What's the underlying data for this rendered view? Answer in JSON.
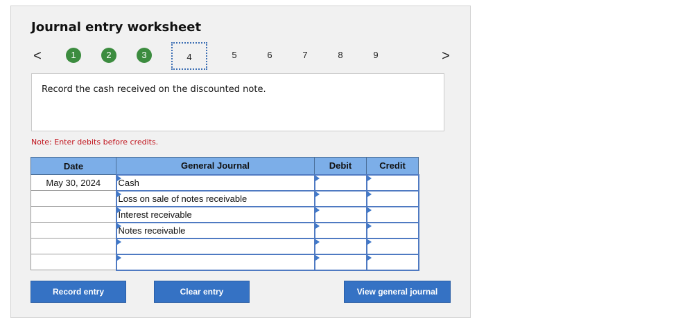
{
  "title": "Journal entry worksheet",
  "stepper": {
    "prev_icon": "chevron-left-icon",
    "next_icon": "chevron-right-icon",
    "prev_glyph": "<",
    "next_glyph": ">",
    "steps": [
      {
        "label": "1",
        "state": "done"
      },
      {
        "label": "2",
        "state": "done"
      },
      {
        "label": "3",
        "state": "done"
      },
      {
        "label": "4",
        "state": "current"
      },
      {
        "label": "5",
        "state": "pending"
      },
      {
        "label": "6",
        "state": "pending"
      },
      {
        "label": "7",
        "state": "pending"
      },
      {
        "label": "8",
        "state": "pending"
      },
      {
        "label": "9",
        "state": "pending"
      }
    ]
  },
  "prompt": "Record the cash received on the discounted note.",
  "note": "Note: Enter debits before credits.",
  "journal": {
    "headers": {
      "date": "Date",
      "account": "General Journal",
      "debit": "Debit",
      "credit": "Credit"
    },
    "rows": [
      {
        "date": "May 30, 2024",
        "account": "Cash",
        "debit": "",
        "credit": ""
      },
      {
        "date": "",
        "account": "Loss on sale of notes receivable",
        "debit": "",
        "credit": ""
      },
      {
        "date": "",
        "account": "Interest receivable",
        "debit": "",
        "credit": ""
      },
      {
        "date": "",
        "account": "Notes receivable",
        "debit": "",
        "credit": ""
      },
      {
        "date": "",
        "account": "",
        "debit": "",
        "credit": ""
      },
      {
        "date": "",
        "account": "",
        "debit": "",
        "credit": ""
      }
    ]
  },
  "buttons": {
    "record": "Record entry",
    "clear": "Clear entry",
    "view": "View general journal"
  },
  "colors": {
    "step_done": "#3c8c3f",
    "table_header": "#7caee8",
    "button": "#3572c4",
    "note_text": "#c0121b"
  }
}
